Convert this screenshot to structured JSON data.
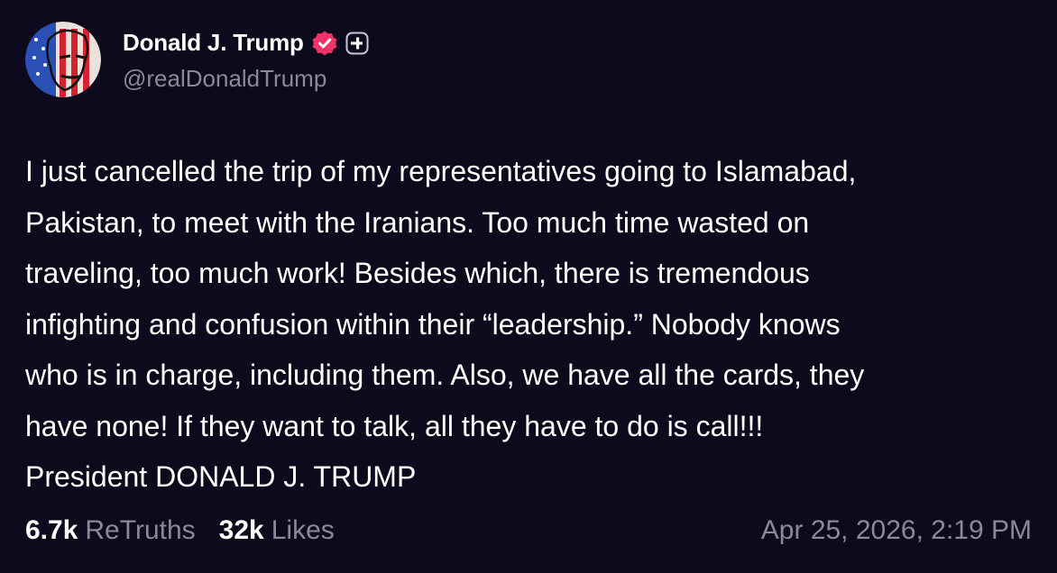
{
  "account": {
    "display_name": "Donald J. Trump",
    "handle": "@realDonaldTrump",
    "verified_icon": "verified-badge-icon",
    "subscribe_icon": "plus-badge-icon"
  },
  "post": {
    "text": "I just cancelled the trip of my representatives going to Islamabad,\nPakistan, to meet with the Iranians. Too much time wasted on\ntraveling, too much work! Besides which, there is tremendous\ninfighting and confusion within their “leadership.” Nobody knows\nwho is in charge, including them. Also, we have all the cards, they\nhave none! If they want to talk, all they have to do is call!!!\nPresident DONALD J. TRUMP",
    "retruths_count": "6.7k",
    "retruths_label": "ReTruths",
    "likes_count": "32k",
    "likes_label": "Likes",
    "timestamp": "Apr 25, 2026, 2:19 PM"
  },
  "colors": {
    "background": "#0c0a1c",
    "text": "#ffffff",
    "muted": "#8a8997",
    "verified_badge": "#f0336a"
  }
}
